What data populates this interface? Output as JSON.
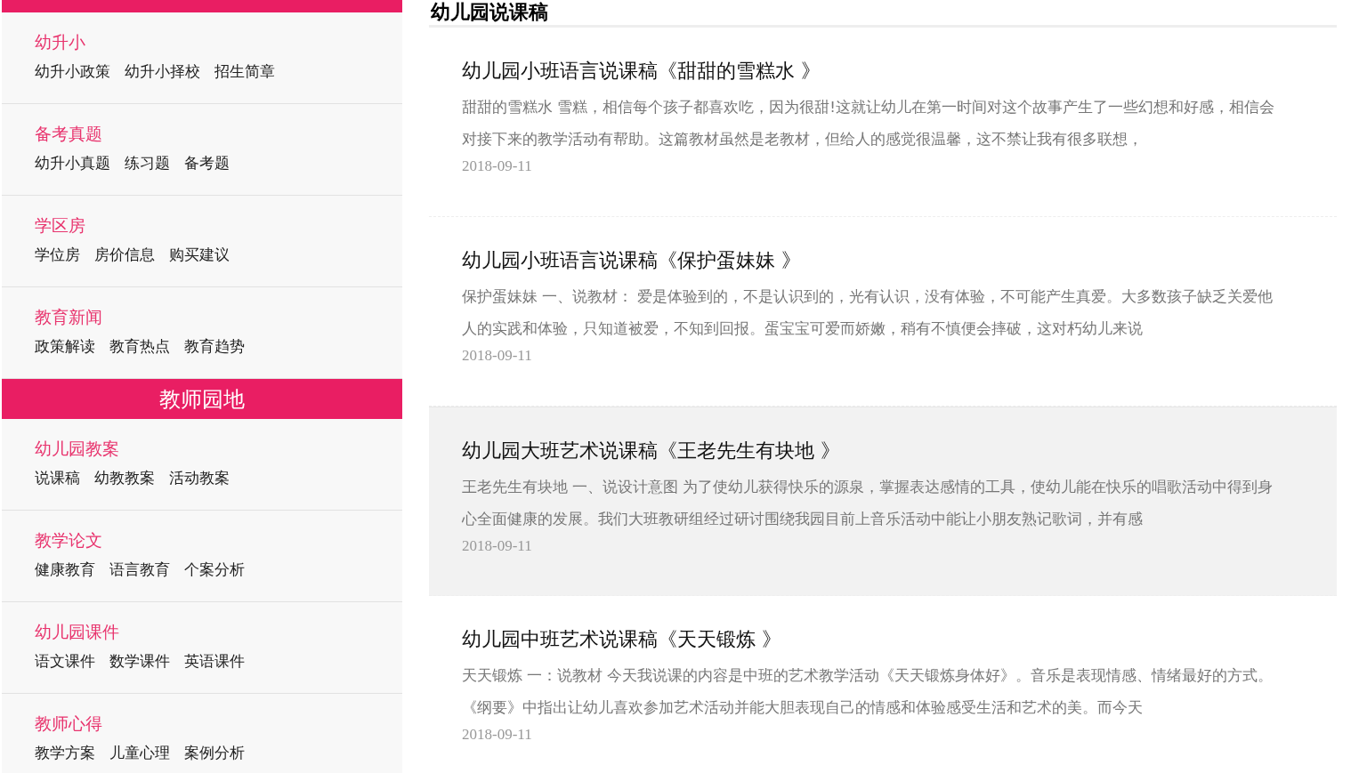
{
  "sidebar": {
    "groups": [
      {
        "kind": "group",
        "sections": [
          {
            "title": "幼升小",
            "links": [
              "幼升小政策",
              "幼升小择校",
              "招生简章"
            ]
          },
          {
            "title": "备考真题",
            "links": [
              "幼升小真题",
              "练习题",
              "备考题"
            ]
          },
          {
            "title": "学区房",
            "links": [
              "学位房",
              "房价信息",
              "购买建议"
            ]
          },
          {
            "title": "教育新闻",
            "links": [
              "政策解读",
              "教育热点",
              "教育趋势"
            ]
          }
        ]
      },
      {
        "kind": "group",
        "header": "教师园地",
        "sections": [
          {
            "title": "幼儿园教案",
            "links": [
              "说课稿",
              "幼教教案",
              "活动教案"
            ]
          },
          {
            "title": "教学论文",
            "links": [
              "健康教育",
              "语言教育",
              "个案分析"
            ]
          },
          {
            "title": "幼儿园课件",
            "links": [
              "语文课件",
              "数学课件",
              "英语课件"
            ]
          },
          {
            "title": "教师心得",
            "links": [
              "教学方案",
              "儿童心理",
              "案例分析"
            ]
          }
        ]
      }
    ]
  },
  "main": {
    "heading": "幼儿园说课稿",
    "articles": [
      {
        "title": "幼儿园小班语言说课稿《甜甜的雪糕水 》",
        "summary": "甜甜的雪糕水 雪糕，相信每个孩子都喜欢吃，因为很甜!这就让幼儿在第一时间对这个故事产生了一些幻想和好感，相信会对接下来的教学活动有帮助。这篇教材虽然是老教材，但给人的感觉很温馨，这不禁让我有很多联想，",
        "date": "2018-09-11",
        "highlighted": false
      },
      {
        "title": "幼儿园小班语言说课稿《保护蛋妹妹 》",
        "summary": "保护蛋妹妹 一、说教材： 爱是体验到的，不是认识到的，光有认识，没有体验，不可能产生真爱。大多数孩子缺乏关爱他人的实践和体验，只知道被爱，不知到回报。蛋宝宝可爱而娇嫩，稍有不慎便会摔破，这对朽幼儿来说",
        "date": "2018-09-11",
        "highlighted": false
      },
      {
        "title": "幼儿园大班艺术说课稿《王老先生有块地 》",
        "summary": "王老先生有块地 一、说设计意图 为了使幼儿获得快乐的源泉，掌握表达感情的工具，使幼儿能在快乐的唱歌活动中得到身心全面健康的发展。我们大班教研组经过研讨围绕我园目前上音乐活动中能让小朋友熟记歌词，并有感",
        "date": "2018-09-11",
        "highlighted": true
      },
      {
        "title": "幼儿园中班艺术说课稿《天天锻炼 》",
        "summary": "天天锻炼 一：说教材 今天我说课的内容是中班的艺术教学活动《天天锻炼身体好》。音乐是表现情感、情绪最好的方式。《纲要》中指出让幼儿喜欢参加艺术活动并能大胆表现自己的情感和体验感受生活和艺术的美。而今天",
        "date": "2018-09-11",
        "highlighted": false
      }
    ]
  }
}
